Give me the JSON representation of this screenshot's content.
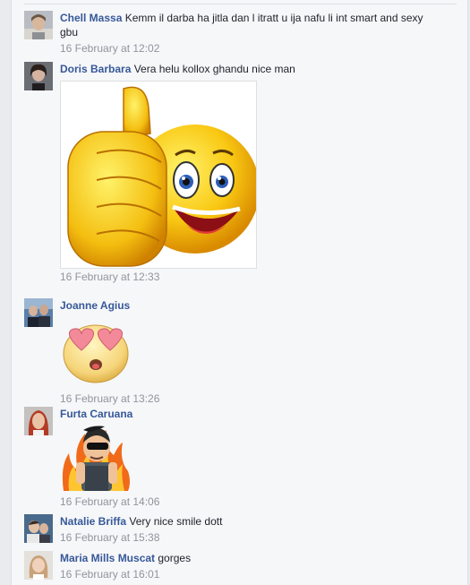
{
  "comments": [
    {
      "author": "Chell Massa",
      "text": "Kemm il darba ha jitla dan l itratt u ija nafu li int smart and sexy gbu",
      "timestamp": "16 February at 12:02"
    },
    {
      "author": "Doris Barbara",
      "text": "Vera helu kollox ghandu nice man",
      "timestamp": "16 February at 12:33",
      "attachment": "thumbs-up-smiley-image"
    },
    {
      "author": "Joanne Agius",
      "text": "",
      "timestamp": "16 February at 13:26",
      "attachment": "heart-eyes-sticker"
    },
    {
      "author": "Furta Caruana",
      "text": "",
      "timestamp": "16 February at 14:06",
      "attachment": "tough-guy-flames-sticker"
    },
    {
      "author": "Natalie Briffa",
      "text": "Very nice smile dott",
      "timestamp": "16 February at 15:38"
    },
    {
      "author": "Maria Mills Muscat",
      "text": "gorges",
      "timestamp": "16 February at 16:01"
    }
  ],
  "colors": {
    "author": "#365899",
    "timestamp": "#90949c",
    "panel": "#f6f7f9"
  }
}
